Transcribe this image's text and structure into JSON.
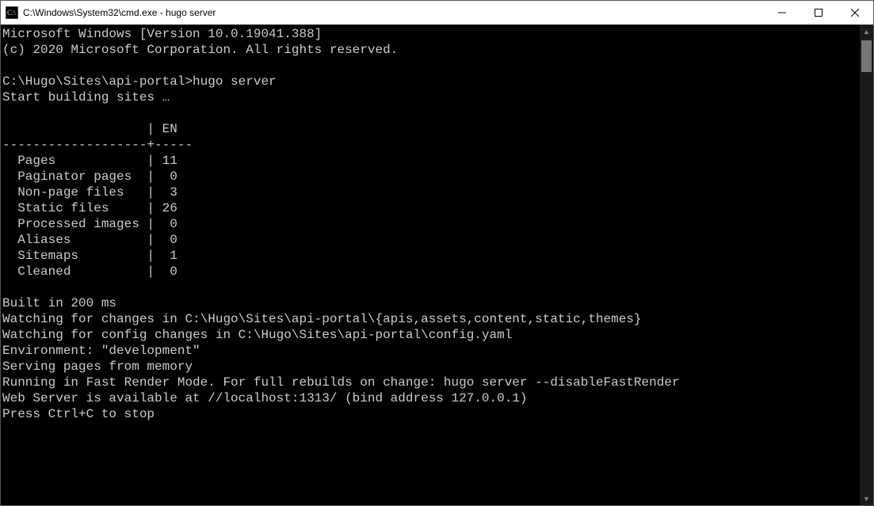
{
  "titlebar": {
    "title": "C:\\Windows\\System32\\cmd.exe - hugo  server"
  },
  "terminal": {
    "lines": [
      "Microsoft Windows [Version 10.0.19041.388]",
      "(c) 2020 Microsoft Corporation. All rights reserved.",
      "",
      "C:\\Hugo\\Sites\\api-portal>hugo server",
      "Start building sites …",
      "",
      "                   | EN",
      "-------------------+-----",
      "  Pages            | 11",
      "  Paginator pages  |  0",
      "  Non-page files   |  3",
      "  Static files     | 26",
      "  Processed images |  0",
      "  Aliases          |  0",
      "  Sitemaps         |  1",
      "  Cleaned          |  0",
      "",
      "Built in 200 ms",
      "Watching for changes in C:\\Hugo\\Sites\\api-portal\\{apis,assets,content,static,themes}",
      "Watching for config changes in C:\\Hugo\\Sites\\api-portal\\config.yaml",
      "Environment: \"development\"",
      "Serving pages from memory",
      "Running in Fast Render Mode. For full rebuilds on change: hugo server --disableFastRender",
      "Web Server is available at //localhost:1313/ (bind address 127.0.0.1)",
      "Press Ctrl+C to stop",
      ""
    ]
  }
}
